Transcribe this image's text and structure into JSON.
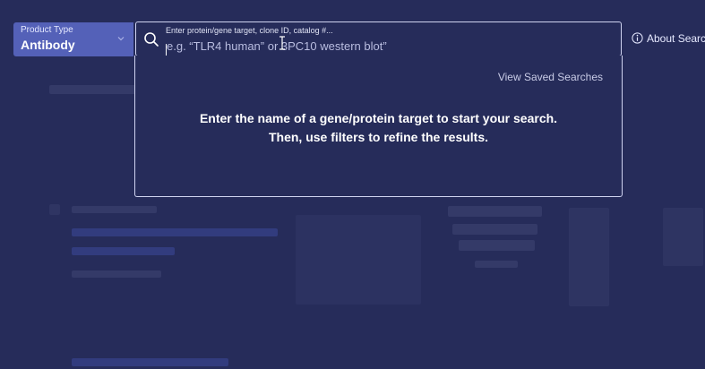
{
  "product_type": {
    "label": "Product Type",
    "value": "Antibody"
  },
  "search": {
    "label": "Enter protein/gene target, clone ID, catalog #...",
    "placeholder": "e.g. “TLR4 human” or 3PC10 western blot”"
  },
  "about_search": "About Search",
  "dropdown": {
    "view_saved": "View Saved Searches",
    "message_line1": "Enter the name of a gene/protein target to start your search.",
    "message_line2": "Then, use filters to refine the results."
  },
  "colors": {
    "background": "#262c5a",
    "product_type_bg": "#5461b8",
    "border": "#cfd3f0"
  }
}
